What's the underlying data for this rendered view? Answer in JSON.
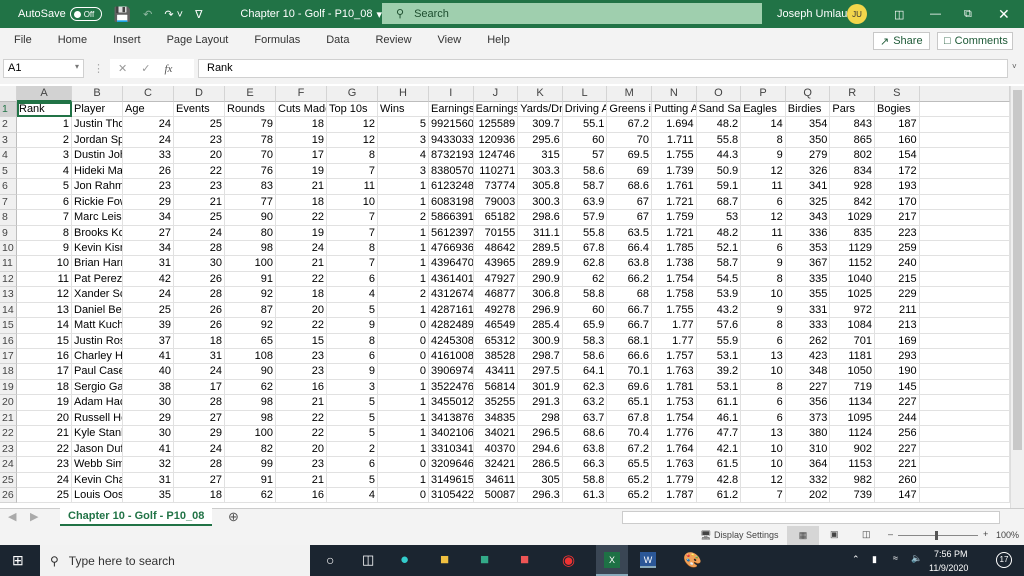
{
  "titlebar": {
    "autosave_label": "AutoSave",
    "autosave_state": "Off",
    "doc_title": "Chapter 10 - Golf - P10_08",
    "search_placeholder": "Search",
    "user_name": "Joseph Umlauf",
    "user_initials": "JU",
    "accent": "#217346"
  },
  "ribbon": {
    "tabs": [
      "File",
      "Home",
      "Insert",
      "Page Layout",
      "Formulas",
      "Data",
      "Review",
      "View",
      "Help"
    ],
    "share_label": "Share",
    "comments_label": "Comments"
  },
  "formula_bar": {
    "name_box": "A1",
    "fx": "fx",
    "value": "Rank"
  },
  "columns": [
    "A",
    "B",
    "C",
    "D",
    "E",
    "F",
    "G",
    "H",
    "I",
    "J",
    "K",
    "L",
    "M",
    "N",
    "O",
    "P",
    "Q",
    "R",
    "S"
  ],
  "headers": [
    "Rank",
    "Player",
    "Age",
    "Events",
    "Rounds",
    "Cuts Made",
    "Top 10s",
    "Wins",
    "Earnings",
    "Earnings p",
    "Yards/Driv",
    "Driving Ac",
    "Greens in",
    "Putting Av",
    "Sand Save",
    "Eagles",
    "Birdies",
    "Pars",
    "Bogies"
  ],
  "rows": [
    [
      "1",
      "Justin Tho",
      "24",
      "25",
      "79",
      "18",
      "12",
      "5",
      "9921560",
      "125589",
      "309.7",
      "55.1",
      "67.2",
      "1.694",
      "48.2",
      "14",
      "354",
      "843",
      "187"
    ],
    [
      "2",
      "Jordan Spi",
      "24",
      "23",
      "78",
      "19",
      "12",
      "3",
      "9433033",
      "120936",
      "295.6",
      "60",
      "70",
      "1.711",
      "55.8",
      "8",
      "350",
      "865",
      "160"
    ],
    [
      "3",
      "Dustin Joh",
      "33",
      "20",
      "70",
      "17",
      "8",
      "4",
      "8732193",
      "124746",
      "315",
      "57",
      "69.5",
      "1.755",
      "44.3",
      "9",
      "279",
      "802",
      "154"
    ],
    [
      "4",
      "Hideki Ma",
      "26",
      "22",
      "76",
      "19",
      "7",
      "3",
      "8380570",
      "110271",
      "303.3",
      "58.6",
      "69",
      "1.739",
      "50.9",
      "12",
      "326",
      "834",
      "172"
    ],
    [
      "5",
      "Jon Rahm",
      "23",
      "23",
      "83",
      "21",
      "11",
      "1",
      "6123248",
      "73774",
      "305.8",
      "58.7",
      "68.6",
      "1.761",
      "59.1",
      "11",
      "341",
      "928",
      "193"
    ],
    [
      "6",
      "Rickie Fow",
      "29",
      "21",
      "77",
      "18",
      "10",
      "1",
      "6083198",
      "79003",
      "300.3",
      "63.9",
      "67",
      "1.721",
      "68.7",
      "6",
      "325",
      "842",
      "170"
    ],
    [
      "7",
      "Marc Leish",
      "34",
      "25",
      "90",
      "22",
      "7",
      "2",
      "5866391",
      "65182",
      "298.6",
      "57.9",
      "67",
      "1.759",
      "53",
      "12",
      "343",
      "1029",
      "217"
    ],
    [
      "8",
      "Brooks Ko",
      "27",
      "24",
      "80",
      "19",
      "7",
      "1",
      "5612397",
      "70155",
      "311.1",
      "55.8",
      "63.5",
      "1.721",
      "48.2",
      "11",
      "336",
      "835",
      "223"
    ],
    [
      "9",
      "Kevin Kisn",
      "34",
      "28",
      "98",
      "24",
      "8",
      "1",
      "4766936",
      "48642",
      "289.5",
      "67.8",
      "66.4",
      "1.785",
      "52.1",
      "6",
      "353",
      "1129",
      "259"
    ],
    [
      "10",
      "Brian Harr",
      "31",
      "30",
      "100",
      "21",
      "7",
      "1",
      "4396470",
      "43965",
      "289.9",
      "62.8",
      "63.8",
      "1.738",
      "58.7",
      "9",
      "367",
      "1152",
      "240"
    ],
    [
      "11",
      "Pat Perez",
      "42",
      "26",
      "91",
      "22",
      "6",
      "1",
      "4361401",
      "47927",
      "290.9",
      "62",
      "66.2",
      "1.754",
      "54.5",
      "8",
      "335",
      "1040",
      "215"
    ],
    [
      "12",
      "Xander Sc",
      "24",
      "28",
      "92",
      "18",
      "4",
      "2",
      "4312674",
      "46877",
      "306.8",
      "58.8",
      "68",
      "1.758",
      "53.9",
      "10",
      "355",
      "1025",
      "229"
    ],
    [
      "13",
      "Daniel Ber",
      "25",
      "26",
      "87",
      "20",
      "5",
      "1",
      "4287161",
      "49278",
      "296.9",
      "60",
      "66.7",
      "1.755",
      "43.2",
      "9",
      "331",
      "972",
      "211"
    ],
    [
      "14",
      "Matt Kuch",
      "39",
      "26",
      "92",
      "22",
      "9",
      "0",
      "4282489",
      "46549",
      "285.4",
      "65.9",
      "66.7",
      "1.77",
      "57.6",
      "8",
      "333",
      "1084",
      "213"
    ],
    [
      "15",
      "Justin Ros",
      "37",
      "18",
      "65",
      "15",
      "8",
      "0",
      "4245308",
      "65312",
      "300.9",
      "58.3",
      "68.1",
      "1.77",
      "55.9",
      "6",
      "262",
      "701",
      "169"
    ],
    [
      "16",
      "Charley H",
      "41",
      "31",
      "108",
      "23",
      "6",
      "0",
      "4161008",
      "38528",
      "298.7",
      "58.6",
      "66.6",
      "1.757",
      "53.1",
      "13",
      "423",
      "1181",
      "293"
    ],
    [
      "17",
      "Paul Casey",
      "40",
      "24",
      "90",
      "23",
      "9",
      "0",
      "3906974",
      "43411",
      "297.5",
      "64.1",
      "70.1",
      "1.763",
      "39.2",
      "10",
      "348",
      "1050",
      "190"
    ],
    [
      "18",
      "Sergio Gar",
      "38",
      "17",
      "62",
      "16",
      "3",
      "1",
      "3522476",
      "56814",
      "301.9",
      "62.3",
      "69.6",
      "1.781",
      "53.1",
      "8",
      "227",
      "719",
      "145"
    ],
    [
      "19",
      "Adam Hac",
      "30",
      "28",
      "98",
      "21",
      "5",
      "1",
      "3455012",
      "35255",
      "291.3",
      "63.2",
      "65.1",
      "1.753",
      "61.1",
      "6",
      "356",
      "1134",
      "227"
    ],
    [
      "20",
      "Russell He",
      "29",
      "27",
      "98",
      "22",
      "5",
      "1",
      "3413876",
      "34835",
      "298",
      "63.7",
      "67.8",
      "1.754",
      "46.1",
      "6",
      "373",
      "1095",
      "244"
    ],
    [
      "21",
      "Kyle Stanl",
      "30",
      "29",
      "100",
      "22",
      "5",
      "1",
      "3402106",
      "34021",
      "296.5",
      "68.6",
      "70.4",
      "1.776",
      "47.7",
      "13",
      "380",
      "1124",
      "256"
    ],
    [
      "22",
      "Jason Duf",
      "41",
      "24",
      "82",
      "20",
      "2",
      "1",
      "3310341",
      "40370",
      "294.6",
      "63.8",
      "67.2",
      "1.764",
      "42.1",
      "10",
      "310",
      "902",
      "227"
    ],
    [
      "23",
      "Webb Sim",
      "32",
      "28",
      "99",
      "23",
      "6",
      "0",
      "3209646",
      "32421",
      "286.5",
      "66.3",
      "65.5",
      "1.763",
      "61.5",
      "10",
      "364",
      "1153",
      "221"
    ],
    [
      "24",
      "Kevin Cha",
      "31",
      "27",
      "91",
      "21",
      "5",
      "1",
      "3149615",
      "34611",
      "305",
      "58.8",
      "65.2",
      "1.779",
      "42.8",
      "12",
      "332",
      "982",
      "260"
    ],
    [
      "25",
      "Louis Oos",
      "35",
      "18",
      "62",
      "16",
      "4",
      "0",
      "3105422",
      "50087",
      "296.3",
      "61.3",
      "65.2",
      "1.787",
      "61.2",
      "7",
      "202",
      "739",
      "147"
    ]
  ],
  "sheet_tab": "Chapter 10 - Golf - P10_08",
  "status": {
    "display_settings": "Display Settings",
    "zoom": "100%"
  },
  "taskbar": {
    "search_placeholder": "Type here to search",
    "time": "7:56 PM",
    "date": "11/9/2020",
    "notifications": "17"
  }
}
